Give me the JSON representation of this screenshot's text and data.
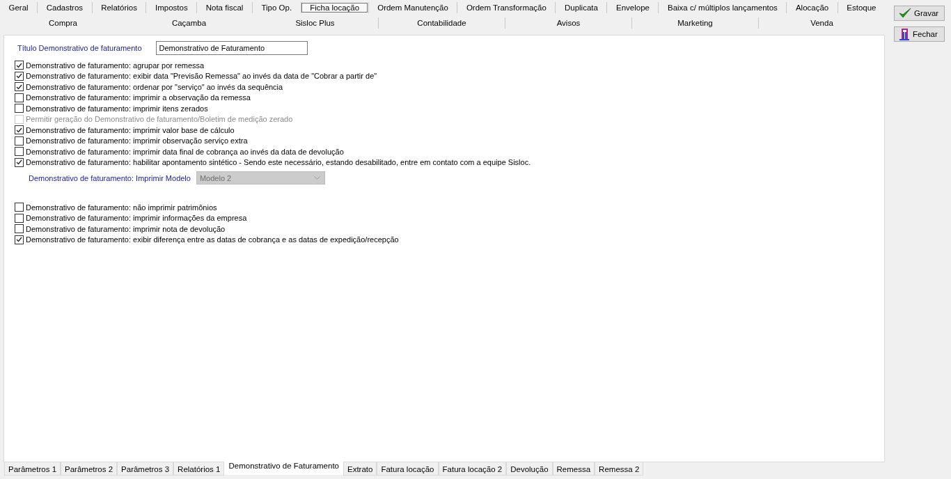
{
  "top_tabs_row1": [
    {
      "label": "Geral",
      "selected": false
    },
    {
      "label": "Cadastros",
      "selected": false
    },
    {
      "label": "Relatórios",
      "selected": false
    },
    {
      "label": "Impostos",
      "selected": false
    },
    {
      "label": "Nota fiscal",
      "selected": false
    },
    {
      "label": "Tipo Op.",
      "selected": false
    },
    {
      "label": "Ficha locação",
      "selected": true
    },
    {
      "label": "Ordem Manutenção",
      "selected": false
    },
    {
      "label": "Ordem Transformação",
      "selected": false
    },
    {
      "label": "Duplicata",
      "selected": false
    },
    {
      "label": "Envelope",
      "selected": false
    },
    {
      "label": "Baixa c/ múltiplos lançamentos",
      "selected": false
    },
    {
      "label": "Alocação",
      "selected": false
    },
    {
      "label": "Estoque",
      "selected": false
    }
  ],
  "top_tabs_row2": [
    {
      "label": "Compra",
      "selected": false
    },
    {
      "label": "Caçamba",
      "selected": false
    },
    {
      "label": "Sisloc Plus",
      "selected": false
    },
    {
      "label": "Contabilidade",
      "selected": false
    },
    {
      "label": "Avisos",
      "selected": false
    },
    {
      "label": "Marketing",
      "selected": false
    },
    {
      "label": "Venda",
      "selected": false
    }
  ],
  "title_field": {
    "label": "Título Demonstrativo de faturamento",
    "value": "Demonstrativo de Faturamento"
  },
  "options": [
    {
      "label": "Demonstrativo de faturamento: agrupar por remessa",
      "checked": true,
      "disabled": false
    },
    {
      "label": "Demonstrativo de faturamento: exibir data \"Previsão Remessa\" ao invés da data de \"Cobrar a partir de\"",
      "checked": true,
      "disabled": false
    },
    {
      "label": "Demonstrativo de faturamento: ordenar por \"serviço\" ao invés da sequência",
      "checked": true,
      "disabled": false
    },
    {
      "label": "Demonstrativo de faturamento: imprimir a observação da remessa",
      "checked": false,
      "disabled": false
    },
    {
      "label": "Demonstrativo de faturamento: imprimir itens zerados",
      "checked": false,
      "disabled": false
    },
    {
      "label": "Permitir geração do Demonstrativo de faturamento/Boletim de medição zerado",
      "checked": false,
      "disabled": true
    },
    {
      "label": "Demonstrativo de faturamento: imprimir valor base de cálculo",
      "checked": true,
      "disabled": false
    },
    {
      "label": "Demonstrativo de faturamento: imprimir observação serviço extra",
      "checked": false,
      "disabled": false
    },
    {
      "label": "Demonstrativo de faturamento: imprimir data final de cobrança ao invés da data de devolução",
      "checked": false,
      "disabled": false
    },
    {
      "label": "Demonstrativo de faturamento: habilitar apontamento sintético - Sendo este necessário, estando desabilitado, entre em contato com a equipe Sisloc.",
      "checked": true,
      "disabled": false
    }
  ],
  "model_select": {
    "label": "Demonstrativo de faturamento: Imprimir Modelo",
    "value": "Modelo 2",
    "disabled": true
  },
  "options_2": [
    {
      "label": "Demonstrativo de faturamento: não imprimir patrimônios",
      "checked": false,
      "disabled": false
    },
    {
      "label": "Demonstrativo de faturamento: imprimir informações da empresa",
      "checked": false,
      "disabled": false
    },
    {
      "label": "Demonstrativo de faturamento: imprimir nota de devolução",
      "checked": false,
      "disabled": false
    },
    {
      "label": "Demonstrativo de faturamento: exibir diferença entre as datas de cobrança e as datas de expedição/recepção",
      "checked": true,
      "disabled": false
    }
  ],
  "buttons": [
    {
      "kind": "save",
      "label": "Gravar"
    },
    {
      "kind": "close",
      "label": "Fechar"
    }
  ],
  "bottom_tabs": [
    {
      "label": "Parâmetros 1",
      "selected": false
    },
    {
      "label": "Parâmetros 2",
      "selected": false
    },
    {
      "label": "Parâmetros 3",
      "selected": false
    },
    {
      "label": "Relatórios 1",
      "selected": false
    },
    {
      "label": "Demonstrativo de Faturamento",
      "selected": true
    },
    {
      "label": "Extrato",
      "selected": false
    },
    {
      "label": "Fatura locação",
      "selected": false
    },
    {
      "label": "Fatura locação 2",
      "selected": false
    },
    {
      "label": "Devolução",
      "selected": false
    },
    {
      "label": "Remessa",
      "selected": false
    },
    {
      "label": "Remessa 2",
      "selected": false
    }
  ]
}
